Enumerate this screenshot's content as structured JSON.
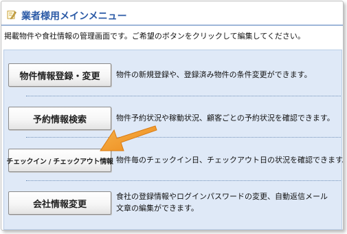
{
  "header": {
    "title": "業者様用メインメニュー",
    "icon": "memo-pencil-icon"
  },
  "description": "掲載物件や食社情報の管理画面です。ご希望のボタンをクリックして編集してください。",
  "menu": [
    {
      "button": "物件情報登録・変更",
      "text": "物件の新規登録や、登録済み物件の条件変更ができます。"
    },
    {
      "button": "予約情報検索",
      "text": "物件予約状況や稼動状況、顧客ごとの予約状況を確認できます。"
    },
    {
      "button": "チェックイン / チェックアウト情報",
      "text": "物件毎のチェックイン日、チェックアウト日の状況を確認できます。"
    },
    {
      "button": "会社情報変更",
      "text_line1": "食社の登録情報やログインパスワードの変更、自動返信メール",
      "text_line2": "文章の編集ができます。"
    }
  ],
  "colors": {
    "title": "#2b5aa6",
    "panel_bg": "#dfe9f7",
    "arrow": "#f39a2b"
  }
}
